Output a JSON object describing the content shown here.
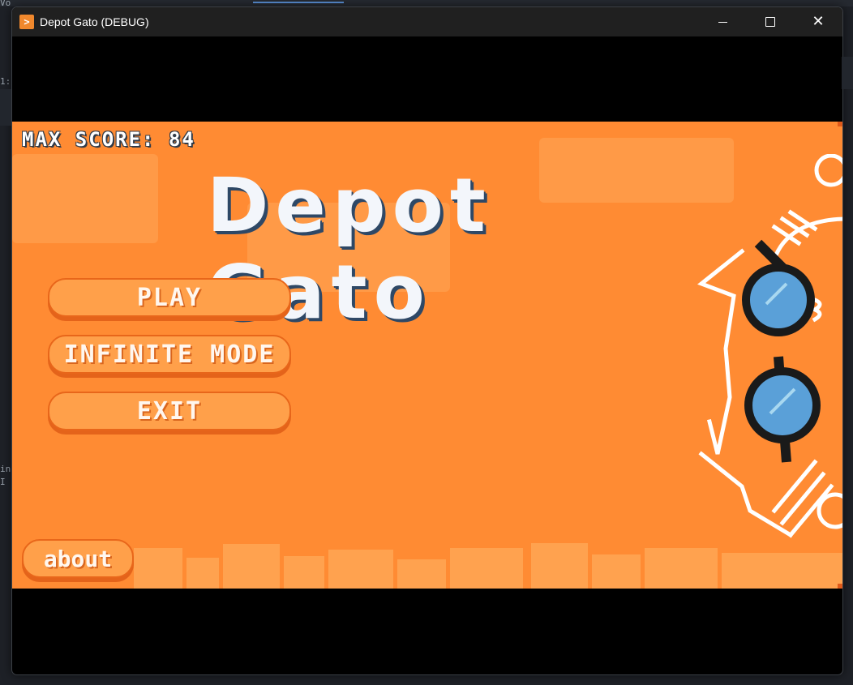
{
  "window": {
    "title": "Depot Gato (DEBUG)",
    "controls": {
      "minimize": "minimize",
      "maximize": "maximize",
      "close": "✕"
    }
  },
  "background_ide": {
    "fragment_top": "Vo",
    "fragment_line": "1:",
    "fragment_a": "in",
    "fragment_b": "I"
  },
  "game": {
    "max_score_label": "MAX SCORE: 84",
    "title": "Depot Gato",
    "menu": [
      {
        "id": "play",
        "label": "PLAY"
      },
      {
        "id": "infinite",
        "label": "INFINITE MODE"
      },
      {
        "id": "exit",
        "label": "EXIT"
      }
    ],
    "about_label": "about",
    "colors": {
      "background": "#ff8b33",
      "button": "#ffa04a",
      "title_text": "#f3f6fb",
      "title_shadow": "#2e4866"
    },
    "art_icons": [
      "cat-doodle-icon",
      "sunglasses-icon"
    ]
  }
}
